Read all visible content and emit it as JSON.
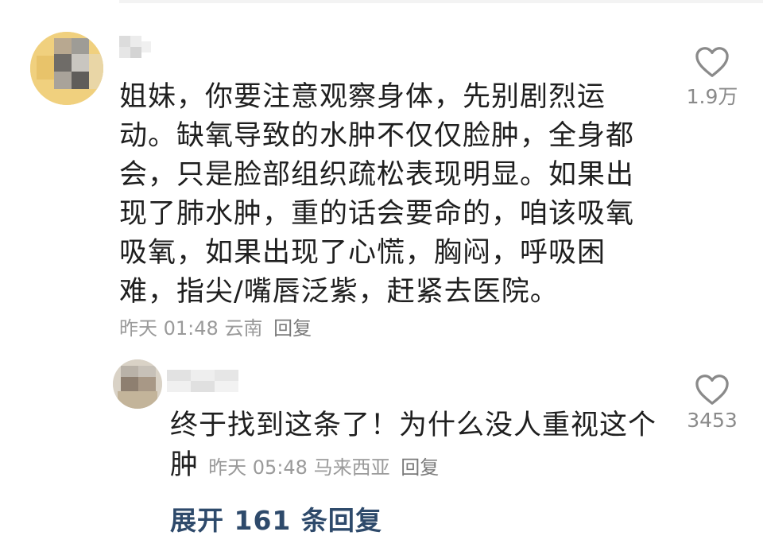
{
  "comment": {
    "text": "姐妹，你要注意观察身体，先别剧烈运动。缺氧导致的水肿不仅仅脸肿，全身都会，只是脸部组织疏松表现明显。如果出现了肺水肿，重的话会要命的，咱该吸氧吸氧，如果出现了心慌，胸闷，呼吸困难，指尖/嘴唇泛紫，赶紧去医院。",
    "time": "昨天 01:48",
    "location": "云南",
    "reply_label": "回复",
    "likes": "1.9万"
  },
  "reply": {
    "text": "终于找到这条了！为什么没人重视这个肿",
    "time": "昨天 05:48",
    "location": "马来西亚",
    "reply_label": "回复",
    "likes": "3453"
  },
  "expand_label": "展开 161 条回复",
  "colors": {
    "text": "#1f1f1f",
    "meta": "#9a9a9a",
    "link": "#2e4a6b",
    "icon": "#8a8a8a"
  },
  "icons": {
    "like": "heart-icon"
  }
}
